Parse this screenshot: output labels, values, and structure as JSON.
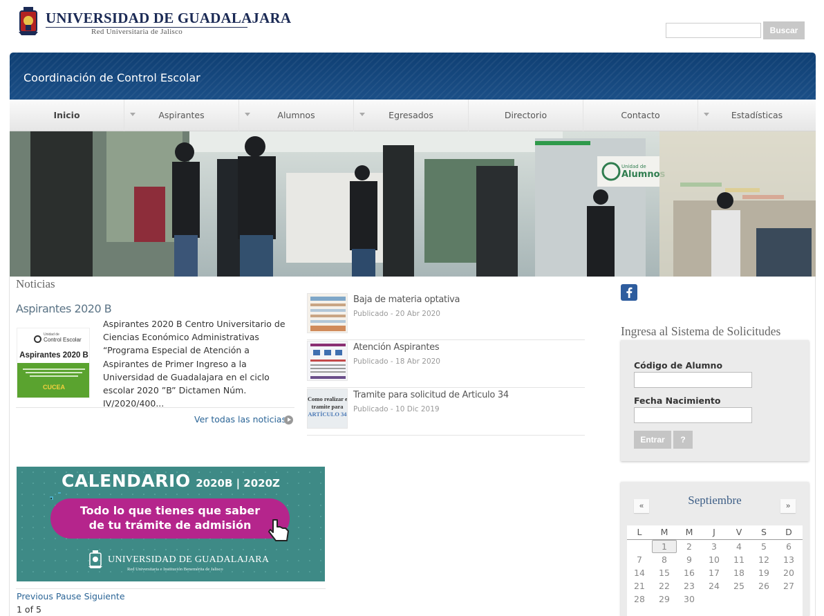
{
  "header": {
    "university_name": "UNIVERSIDAD DE GUADALAJARA",
    "university_subtitle": "Red Universitaria de Jalisco",
    "search_button": "Buscar"
  },
  "banner": {
    "title": "Coordinación de Control Escolar"
  },
  "nav": {
    "items": [
      {
        "label": "Inicio",
        "dropdown": false,
        "bold": true
      },
      {
        "label": "Aspirantes",
        "dropdown": true
      },
      {
        "label": "Alumnos",
        "dropdown": true
      },
      {
        "label": "Egresados",
        "dropdown": true
      },
      {
        "label": "Directorio",
        "dropdown": false
      },
      {
        "label": "Contacto",
        "dropdown": false
      },
      {
        "label": "Estadísticas",
        "dropdown": true
      }
    ]
  },
  "hero": {
    "sign_label": "Alumnos",
    "sign_small": "Unidad de"
  },
  "news": {
    "heading": "Noticias",
    "featured": {
      "title": "Aspirantes 2020 B",
      "thumb_logo": "Control Escolar",
      "thumb_logo_small": "Unidad de",
      "thumb_title": "Aspirantes 2020 B",
      "thumb_brand": "CUCEA",
      "summary": "Aspirantes 2020 B Centro Universitario de Ciencias Económico Administrativas “Programa Especial de Atención a Aspirantes de Primer Ingreso a la Universidad de Guadalajara en el ciclo escolar 2020 ”B” Dictamen Núm. IV/2020/400..."
    },
    "all_news_link": "Ver todas las noticias",
    "items": [
      {
        "title": "Baja de materia optativa",
        "date": "Publicado - 20 Abr 2020"
      },
      {
        "title": "Atención Aspirantes",
        "date": "Publicado - 18 Abr 2020"
      },
      {
        "title": "Tramite para solicitud de Articulo 34",
        "date": "Publicado - 10 Dic 2019",
        "thumb_text": [
          "Como realizar el",
          "tramite para",
          "ARTÍCULO 34"
        ]
      }
    ]
  },
  "promo": {
    "title": "CALENDARIO",
    "title_years": "2020B | 2020Z",
    "line1": "Todo lo que tienes que saber",
    "line2": "de tu trámite de admisión",
    "footer_name": "UNIVERSIDAD DE GUADALAJARA",
    "footer_sub": "Red Universitaria e Institución Benemérita de Jalisco"
  },
  "slider": {
    "previous": "Previous",
    "pause": "Pause",
    "next": "Siguiente",
    "count": "1 of 5"
  },
  "sidebar": {
    "login_heading": "Ingresa al Sistema de Solicitudes",
    "student_code_label": "Código de Alumno",
    "birth_date_label": "Fecha Nacimiento",
    "enter_button": "Entrar",
    "help_button": "?"
  },
  "calendar": {
    "month": "Septiembre",
    "prev": "«",
    "next": "»",
    "weekdays": [
      "L",
      "M",
      "M",
      "J",
      "V",
      "S",
      "D"
    ],
    "weeks": [
      [
        "",
        "1",
        "2",
        "3",
        "4",
        "5",
        "6"
      ],
      [
        "7",
        "8",
        "9",
        "10",
        "11",
        "12",
        "13"
      ],
      [
        "14",
        "15",
        "16",
        "17",
        "18",
        "19",
        "20"
      ],
      [
        "21",
        "22",
        "23",
        "24",
        "25",
        "26",
        "27"
      ],
      [
        "28",
        "29",
        "30",
        "",
        "",
        "",
        ""
      ]
    ],
    "today": "1"
  },
  "colors": {
    "brand_blue": "#1b4f87",
    "link": "#2a6496",
    "facebook": "#2e5d9e",
    "promo_teal": "#3e8a86",
    "promo_magenta": "#b5258c"
  }
}
